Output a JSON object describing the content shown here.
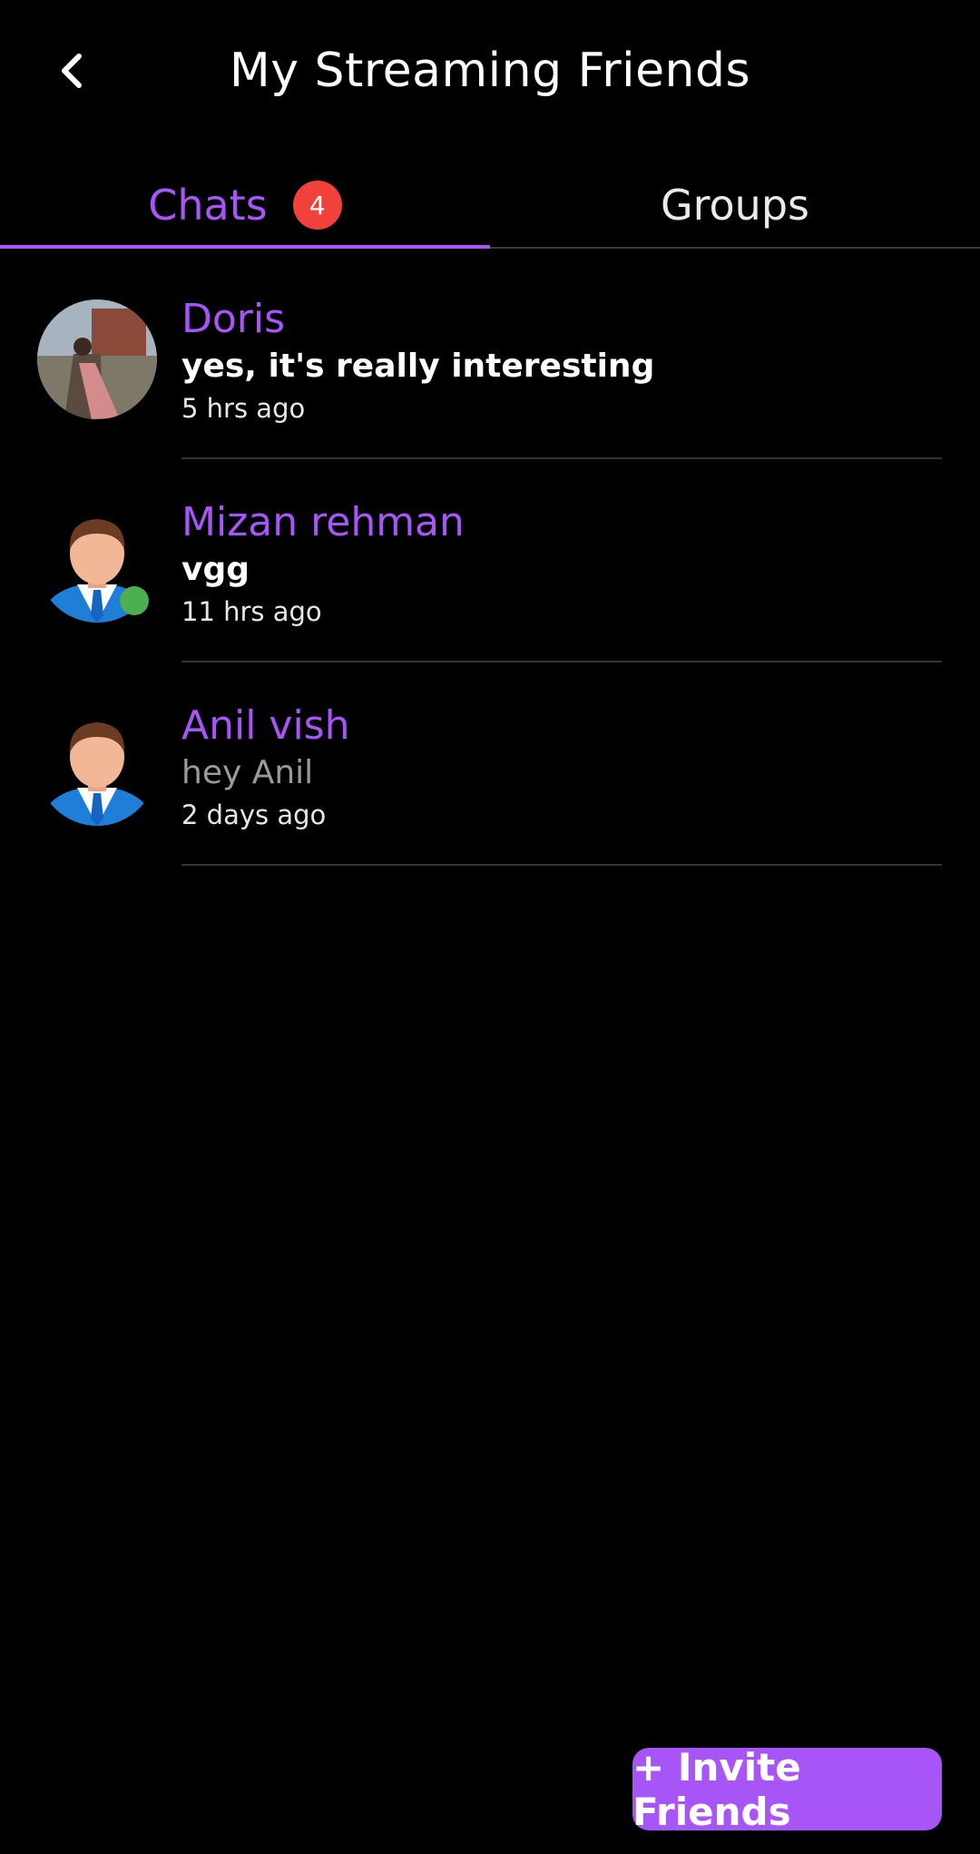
{
  "header": {
    "title": "My Streaming Friends"
  },
  "tabs": [
    {
      "label": "Chats",
      "badge": "4",
      "active": true
    },
    {
      "label": "Groups",
      "active": false
    }
  ],
  "chats": [
    {
      "name": "Doris",
      "message": "yes, it's really interesting",
      "time": "5 hrs ago",
      "unread": true,
      "online": false,
      "avatar": "photo"
    },
    {
      "name": "Mizan rehman",
      "message": "vgg",
      "time": "11 hrs ago",
      "unread": true,
      "online": true,
      "avatar": "default-person-icon"
    },
    {
      "name": "Anil vish",
      "message": "hey Anil",
      "time": "2 days ago",
      "unread": false,
      "online": false,
      "avatar": "default-person-icon"
    }
  ],
  "invite_button": {
    "label": "+ Invite Friends"
  },
  "colors": {
    "accent": "#a855f7",
    "badge": "#f0413a",
    "online": "#4caf50",
    "background": "#000000"
  }
}
